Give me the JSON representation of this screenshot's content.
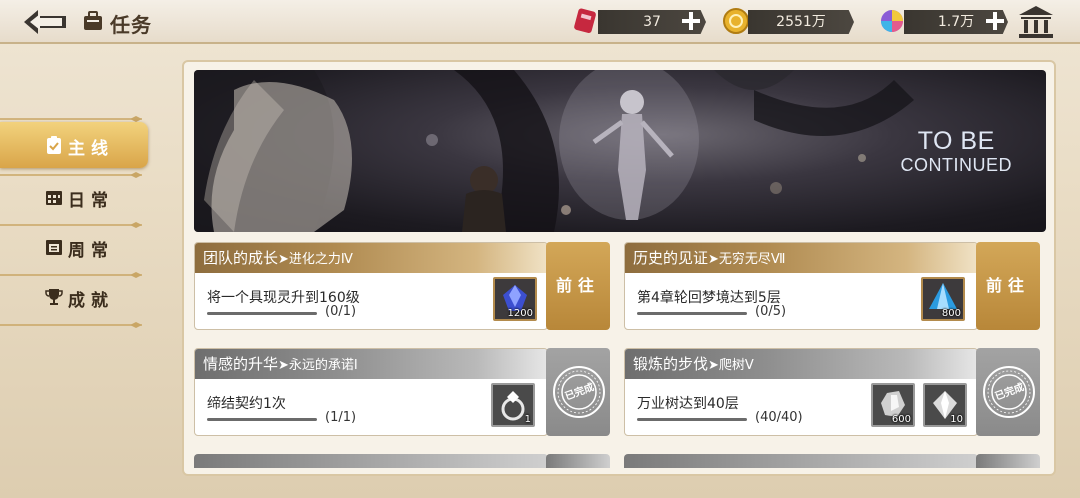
{
  "header": {
    "title": "任务",
    "resources": [
      {
        "name": "stamina-ticket",
        "value": "37"
      },
      {
        "name": "gold-coin",
        "value": "2551万"
      },
      {
        "name": "rainbow-crystal",
        "value": "1.7万"
      }
    ]
  },
  "sidebar": {
    "tabs": [
      {
        "label": "主线",
        "icon": "clipboard-check-icon",
        "active": true
      },
      {
        "label": "日常",
        "icon": "calendar-icon",
        "active": false
      },
      {
        "label": "周常",
        "icon": "week-calendar-icon",
        "active": false
      },
      {
        "label": "成就",
        "icon": "trophy-icon",
        "active": false
      }
    ]
  },
  "banner": {
    "line1": "TO BE",
    "line2": "CONTINUED"
  },
  "tasks": [
    {
      "title": "团队的成长",
      "subtitle": "➤进化之力Ⅳ",
      "desc": "将一个具现灵升到160级",
      "progress": "(0/1)",
      "fraction": 0,
      "status": "active",
      "action_label": "前往",
      "rewards": [
        {
          "icon": "blue-gem-icon",
          "count": "1200"
        }
      ]
    },
    {
      "title": "历史的见证",
      "subtitle": "➤无穷无尽Ⅶ",
      "desc": "第4章轮回梦境达到5层",
      "progress": "(0/5)",
      "fraction": 0,
      "status": "active",
      "action_label": "前往",
      "rewards": [
        {
          "icon": "blue-crystal-icon",
          "count": "800"
        }
      ]
    },
    {
      "title": "情感的升华",
      "subtitle": "➤永远的承诺Ⅰ",
      "desc": "缔结契约1次",
      "progress": "(1/1)",
      "fraction": 1,
      "status": "done",
      "done_label": "已完成",
      "rewards": [
        {
          "icon": "ring-icon",
          "count": "1"
        }
      ]
    },
    {
      "title": "锻炼的步伐",
      "subtitle": "➤爬树Ⅴ",
      "desc": "万业树达到40层",
      "progress": "(40/40)",
      "fraction": 1,
      "status": "done",
      "done_label": "已完成",
      "rewards": [
        {
          "icon": "silver-crystal-icon",
          "count": "600"
        },
        {
          "icon": "silver-gem-icon",
          "count": "10"
        }
      ]
    }
  ],
  "colors": {
    "accent_gold": "#d3a758",
    "done_grey": "#8a8a8a",
    "text_dark": "#3b2d1d"
  }
}
